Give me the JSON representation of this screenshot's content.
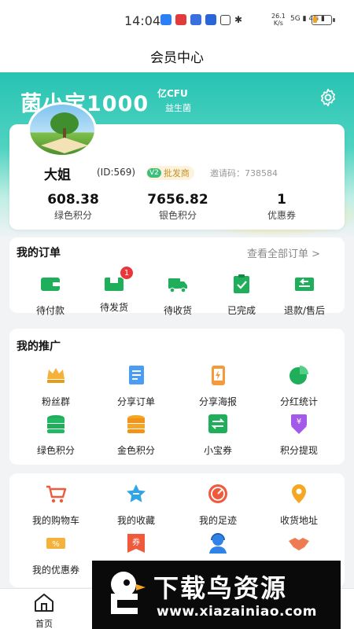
{
  "status_bar": {
    "time": "14:04",
    "speed_value": "26.1",
    "speed_unit": "K/s",
    "network": "5G",
    "network2": "4G",
    "battery_level": 0.25
  },
  "header": {
    "title": "会员中心"
  },
  "banner": {
    "brand": "菌小宝1000",
    "brand_sup": "亿CFU",
    "brand_sub": "益生菌"
  },
  "profile": {
    "name": "大姐",
    "id": "(ID:569)",
    "level_tag": "V2",
    "level_name": "批发商",
    "invite_code": "邀请码：738584",
    "stats": [
      {
        "value": "608.38",
        "label": "绿色积分"
      },
      {
        "value": "7656.82",
        "label": "银色积分"
      },
      {
        "value": "1",
        "label": "优惠券"
      }
    ]
  },
  "orders": {
    "title": "我的订单",
    "see_all": "查看全部订单 >",
    "items": [
      {
        "label": "待付款",
        "icon": "wallet-icon"
      },
      {
        "label": "待发货",
        "icon": "package-icon",
        "badge": "1"
      },
      {
        "label": "待收货",
        "icon": "truck-icon"
      },
      {
        "label": "已完成",
        "icon": "clipboard-check-icon"
      },
      {
        "label": "退款/售后",
        "icon": "refund-icon"
      }
    ]
  },
  "promotion": {
    "title": "我的推广",
    "items": [
      {
        "label": "粉丝群",
        "icon": "fans-icon"
      },
      {
        "label": "分享订单",
        "icon": "share-order-icon"
      },
      {
        "label": "分享海报",
        "icon": "poster-icon"
      },
      {
        "label": "分红统计",
        "icon": "pie-chart-icon"
      },
      {
        "label": "绿色积分",
        "icon": "green-coins-icon"
      },
      {
        "label": "金色积分",
        "icon": "gold-coins-icon"
      },
      {
        "label": "小宝券",
        "icon": "exchange-icon"
      },
      {
        "label": "积分提现",
        "icon": "withdraw-icon"
      }
    ]
  },
  "services": {
    "items": [
      {
        "label": "我的购物车",
        "icon": "cart-icon"
      },
      {
        "label": "我的收藏",
        "icon": "star-icon"
      },
      {
        "label": "我的足迹",
        "icon": "footprint-icon"
      },
      {
        "label": "收货地址",
        "icon": "location-icon"
      },
      {
        "label": "我的优惠券",
        "icon": "coupon-icon"
      },
      {
        "label": "",
        "icon": "voucher-icon",
        "glyph": "券"
      },
      {
        "label": "",
        "icon": "service-agent-icon"
      },
      {
        "label": "",
        "icon": "handshake-icon"
      }
    ]
  },
  "bottom_nav": [
    {
      "label": "首页",
      "icon": "home-icon"
    },
    {
      "label": "",
      "icon": ""
    },
    {
      "label": "",
      "icon": ""
    },
    {
      "label": "",
      "icon": ""
    }
  ],
  "watermark": {
    "title": "下载鸟资源",
    "url": "www.xiazainiao.com"
  },
  "colors": {
    "accent": "#27c3b2",
    "green": "#1fae5a",
    "red_badge": "#e8363a"
  }
}
